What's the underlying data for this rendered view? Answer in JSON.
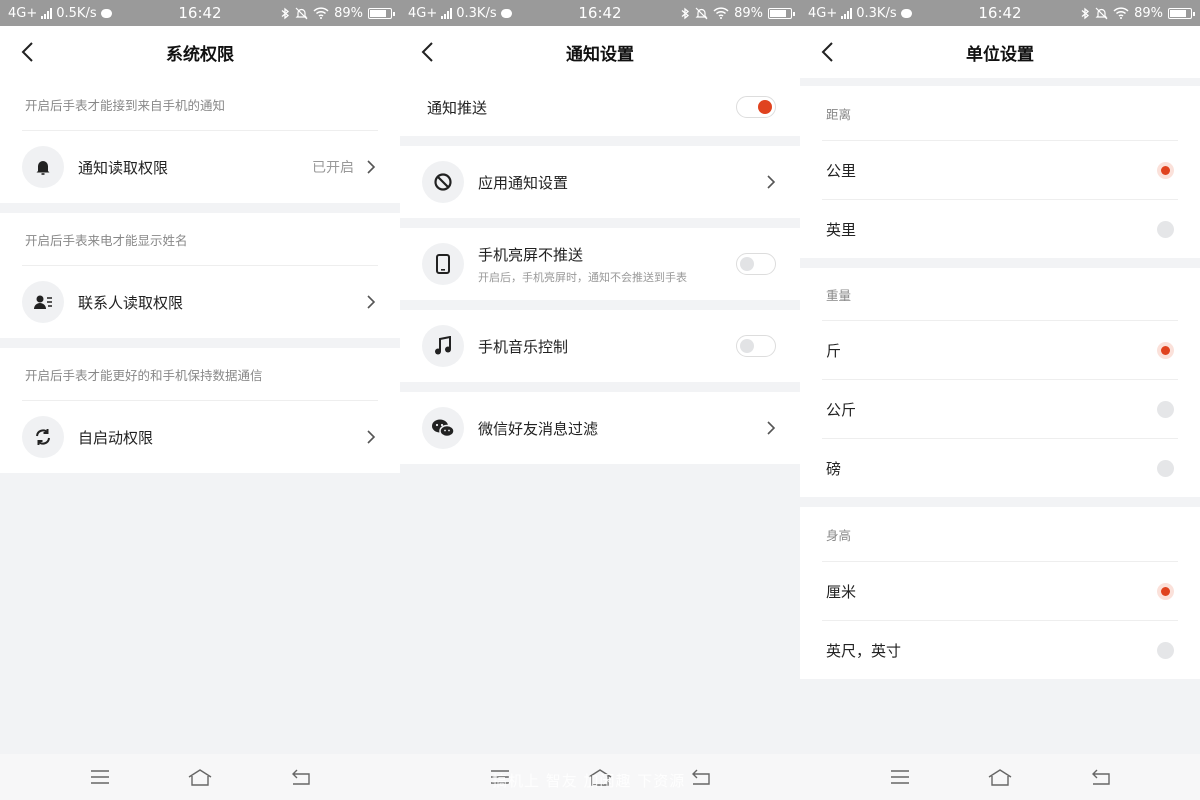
{
  "screens": [
    {
      "status": {
        "network": "4G+",
        "speed": "0.5K/s",
        "time": "16:42",
        "battery": "89%"
      },
      "title": "系统权限",
      "sections": [
        {
          "hint": "开启后手表才能接到来自手机的通知",
          "item": {
            "label": "通知读取权限",
            "value": "已开启",
            "icon": "bell-icon"
          }
        },
        {
          "hint": "开启后手表来电才能显示姓名",
          "item": {
            "label": "联系人读取权限",
            "icon": "contact-card-icon"
          }
        },
        {
          "hint": "开启后手表才能更好的和手机保持数据通信",
          "item": {
            "label": "自启动权限",
            "icon": "sync-icon"
          }
        }
      ]
    },
    {
      "status": {
        "network": "4G+",
        "speed": "0.3K/s",
        "time": "16:42",
        "battery": "89%"
      },
      "title": "通知设置",
      "push": {
        "label": "通知推送",
        "on": true
      },
      "items": [
        {
          "label": "应用通知设置",
          "icon": "block-icon",
          "control": "chevron"
        },
        {
          "label": "手机亮屏不推送",
          "sub": "开启后，手机亮屏时，通知不会推送到手表",
          "icon": "phone-icon",
          "control": "toggle",
          "on": false
        },
        {
          "label": "手机音乐控制",
          "icon": "music-note-icon",
          "control": "toggle",
          "on": false
        },
        {
          "label": "微信好友消息过滤",
          "icon": "wechat-icon",
          "control": "chevron"
        }
      ]
    },
    {
      "status": {
        "network": "4G+",
        "speed": "0.3K/s",
        "time": "16:42",
        "battery": "89%"
      },
      "title": "单位设置",
      "groups": [
        {
          "heading": "距离",
          "options": [
            {
              "label": "公里",
              "selected": true
            },
            {
              "label": "英里",
              "selected": false
            }
          ]
        },
        {
          "heading": "重量",
          "options": [
            {
              "label": "斤",
              "selected": true
            },
            {
              "label": "公斤",
              "selected": false
            },
            {
              "label": "磅",
              "selected": false
            }
          ]
        },
        {
          "heading": "身高",
          "options": [
            {
              "label": "厘米",
              "selected": true
            },
            {
              "label": "英尺，英寸",
              "selected": false
            }
          ]
        }
      ]
    }
  ],
  "watermark": "搞机上 智友 加闲趣 下资源",
  "colors": {
    "accent": "#e0431f",
    "page_bg": "#f2f3f5",
    "status_bar": "#9a9a9a"
  }
}
